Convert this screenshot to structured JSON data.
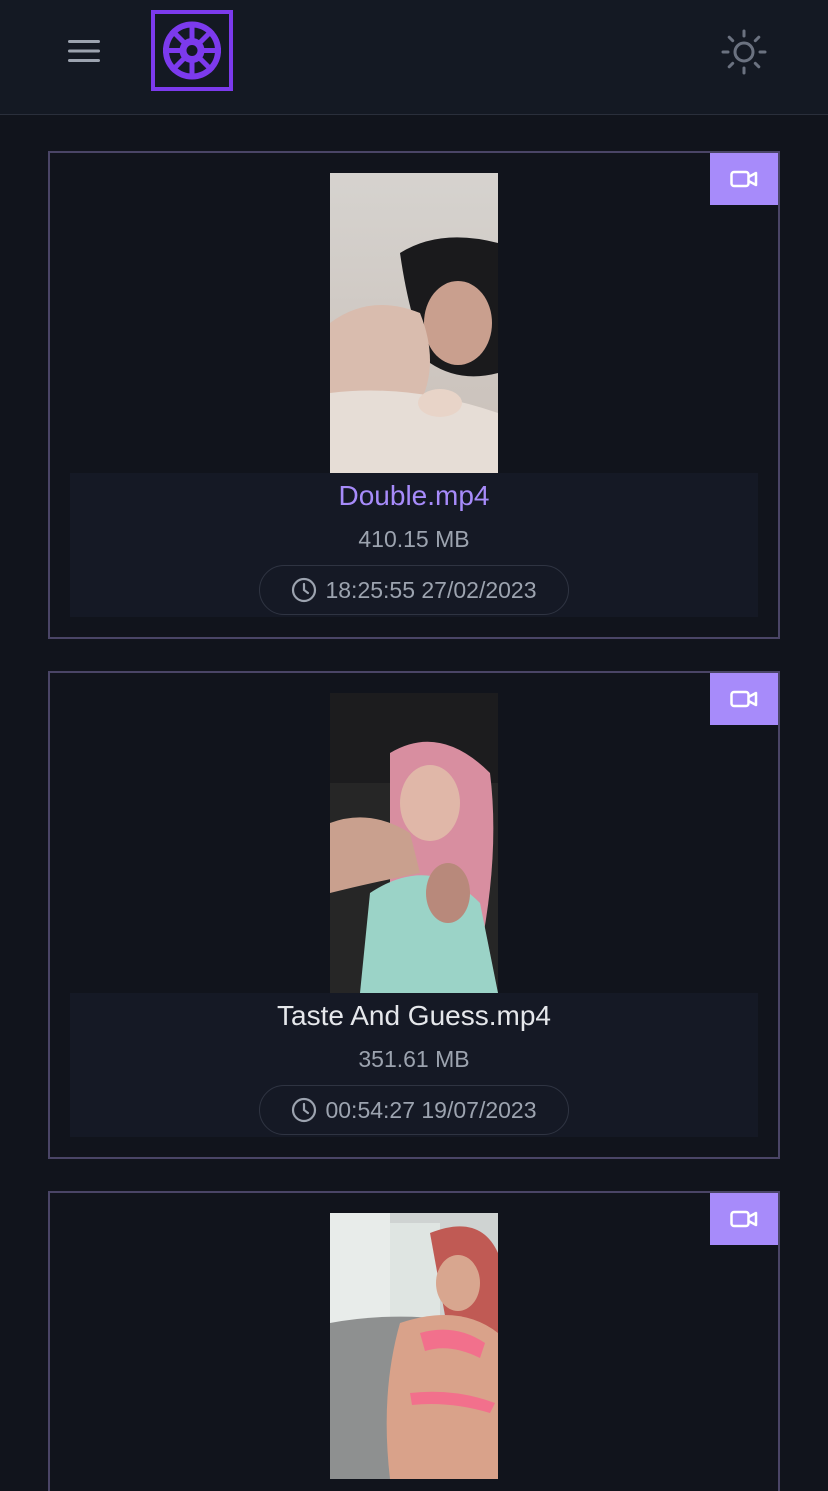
{
  "header": {
    "menu_icon": "hamburger-menu-icon",
    "logo_icon": "vault-wheel-logo",
    "theme_icon": "sun-icon",
    "colors": {
      "background": "#141923",
      "accent": "#7c3aed",
      "icon": "#9ca3af"
    }
  },
  "media": [
    {
      "name": "Double.mp4",
      "size": "410.15 MB",
      "date": "18:25:55 27/02/2023",
      "type_icon": "video-camera-icon",
      "active": true
    },
    {
      "name": "Taste And Guess.mp4",
      "size": "351.61 MB",
      "date": "00:54:27 19/07/2023",
      "type_icon": "video-camera-icon",
      "active": false
    },
    {
      "name": "",
      "size": "",
      "date": "",
      "type_icon": "video-camera-icon",
      "active": false
    }
  ],
  "colors": {
    "page_background": "#11141c",
    "card_border": "#4a4566",
    "badge": "#a78bfa",
    "active_title": "#a78bfa",
    "title": "#e5e7eb",
    "muted_text": "#9ca3af"
  }
}
